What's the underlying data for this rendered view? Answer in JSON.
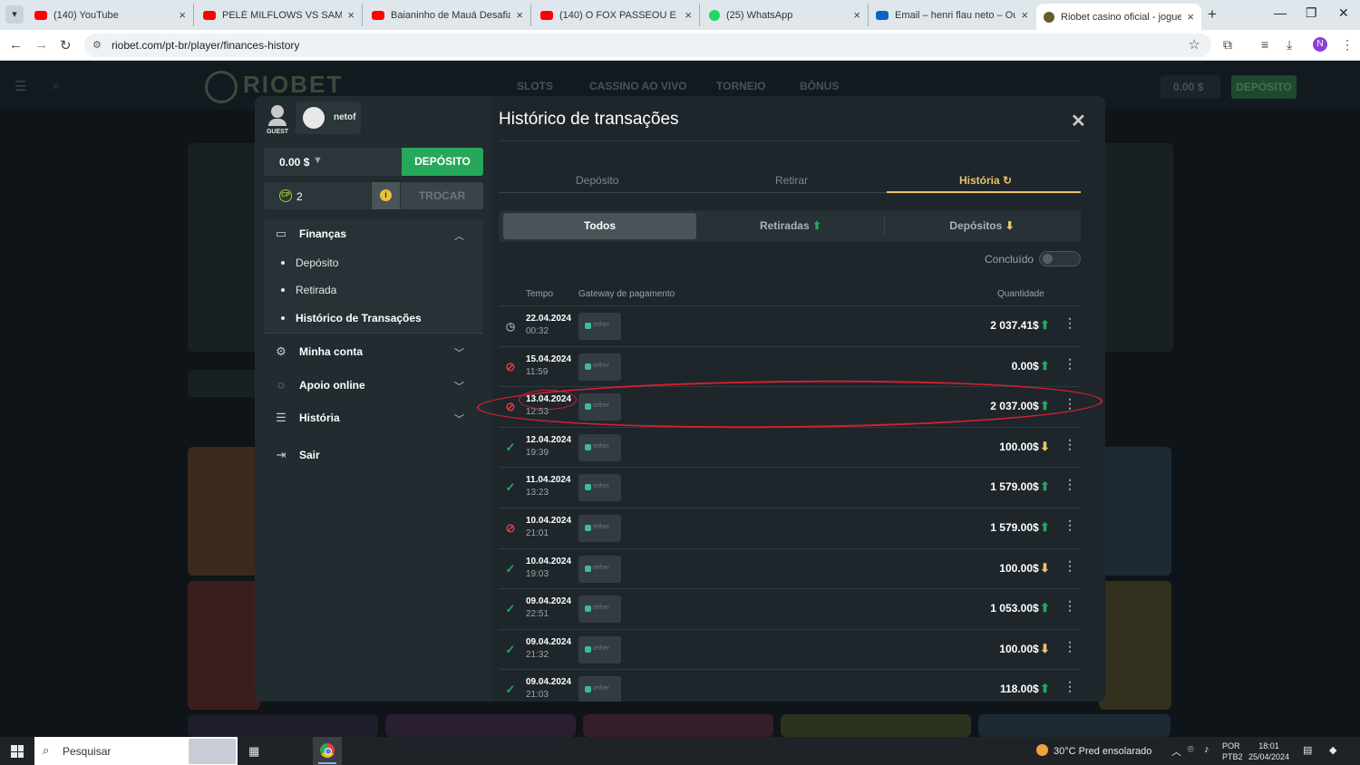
{
  "browser": {
    "tabs": [
      {
        "title": "(140) YouTube",
        "favicon": "youtube-icon"
      },
      {
        "title": "PELÉ MILFLOWS VS SAMURAI |",
        "favicon": "youtube-icon"
      },
      {
        "title": "Baianinho de Mauá Desafia os",
        "favicon": "youtube-icon"
      },
      {
        "title": "(140) O FOX PASSEOU E CARRE",
        "favicon": "youtube-icon"
      },
      {
        "title": "(25) WhatsApp",
        "favicon": "whatsapp-icon"
      },
      {
        "title": "Email – henri flau neto – Outlo",
        "favicon": "outlook-icon"
      },
      {
        "title": "Riobet casino oficial - jogue cas",
        "favicon": "riobet-icon"
      }
    ],
    "url": "riobet.com/pt-br/player/finances-history",
    "profile_initial": "N"
  },
  "site": {
    "logo": "RIOBET",
    "nav": [
      "SLOTS",
      "CASSINO AO VIVO",
      "TORNEIO",
      "BÔNUS"
    ],
    "balance": "0.00 $",
    "deposit": "DEPÓSITO"
  },
  "sidebar": {
    "guest_label": "GUEST",
    "username": "netof",
    "balance": "0.00 $",
    "deposit_button": "DEPÓSITO",
    "cp_count": "2",
    "trocar_button": "TROCAR",
    "finance_section": "Finanças",
    "finance_items": [
      "Depósito",
      "Retirada",
      "Histórico de Transações"
    ],
    "account": "Minha conta",
    "support": "Apoio online",
    "history": "História",
    "logout": "Sair"
  },
  "main": {
    "title": "Histórico de transações",
    "tabs": [
      "Depósito",
      "Retirar",
      "História"
    ],
    "active_tab": "História",
    "filters": [
      "Todos",
      "Retiradas",
      "Depósitos"
    ],
    "completed_label": "Concluído",
    "columns": {
      "time": "Tempo",
      "gateway": "Gateway de pagamento",
      "amount": "Quantidade"
    },
    "gateway_label": "tether",
    "transactions": [
      {
        "date": "22.04.2024",
        "time": "00:32",
        "status": "pending",
        "amount": "2 037.41",
        "currency": "$",
        "direction": "withdrawal"
      },
      {
        "date": "15.04.2024",
        "time": "11:59",
        "status": "cancelled",
        "amount": "0.00",
        "currency": "$",
        "direction": "withdrawal"
      },
      {
        "date": "13.04.2024",
        "time": "12:53",
        "status": "cancelled",
        "amount": "2 037.00",
        "currency": "$",
        "direction": "withdrawal"
      },
      {
        "date": "12.04.2024",
        "time": "19:39",
        "status": "completed",
        "amount": "100.00",
        "currency": "$",
        "direction": "deposit"
      },
      {
        "date": "11.04.2024",
        "time": "13:23",
        "status": "completed",
        "amount": "1 579.00",
        "currency": "$",
        "direction": "withdrawal"
      },
      {
        "date": "10.04.2024",
        "time": "21:01",
        "status": "cancelled",
        "amount": "1 579.00",
        "currency": "$",
        "direction": "withdrawal"
      },
      {
        "date": "10.04.2024",
        "time": "19:03",
        "status": "completed",
        "amount": "100.00",
        "currency": "$",
        "direction": "deposit"
      },
      {
        "date": "09.04.2024",
        "time": "22:51",
        "status": "completed",
        "amount": "1 053.00",
        "currency": "$",
        "direction": "withdrawal"
      },
      {
        "date": "09.04.2024",
        "time": "21:32",
        "status": "completed",
        "amount": "100.00",
        "currency": "$",
        "direction": "deposit"
      },
      {
        "date": "09.04.2024",
        "time": "21:03",
        "status": "completed",
        "amount": "118.00",
        "currency": "$",
        "direction": "withdrawal"
      }
    ]
  },
  "taskbar": {
    "search_placeholder": "Pesquisar",
    "weather": "30°C  Pred ensolarado",
    "lang_1": "POR",
    "lang_2": "PTB2",
    "clock_time": "18:01",
    "clock_date": "25/04/2024"
  },
  "colors": {
    "accent_green": "#25a85a",
    "accent_gold": "#e9c46a",
    "cancel_red": "#e53a3a"
  }
}
